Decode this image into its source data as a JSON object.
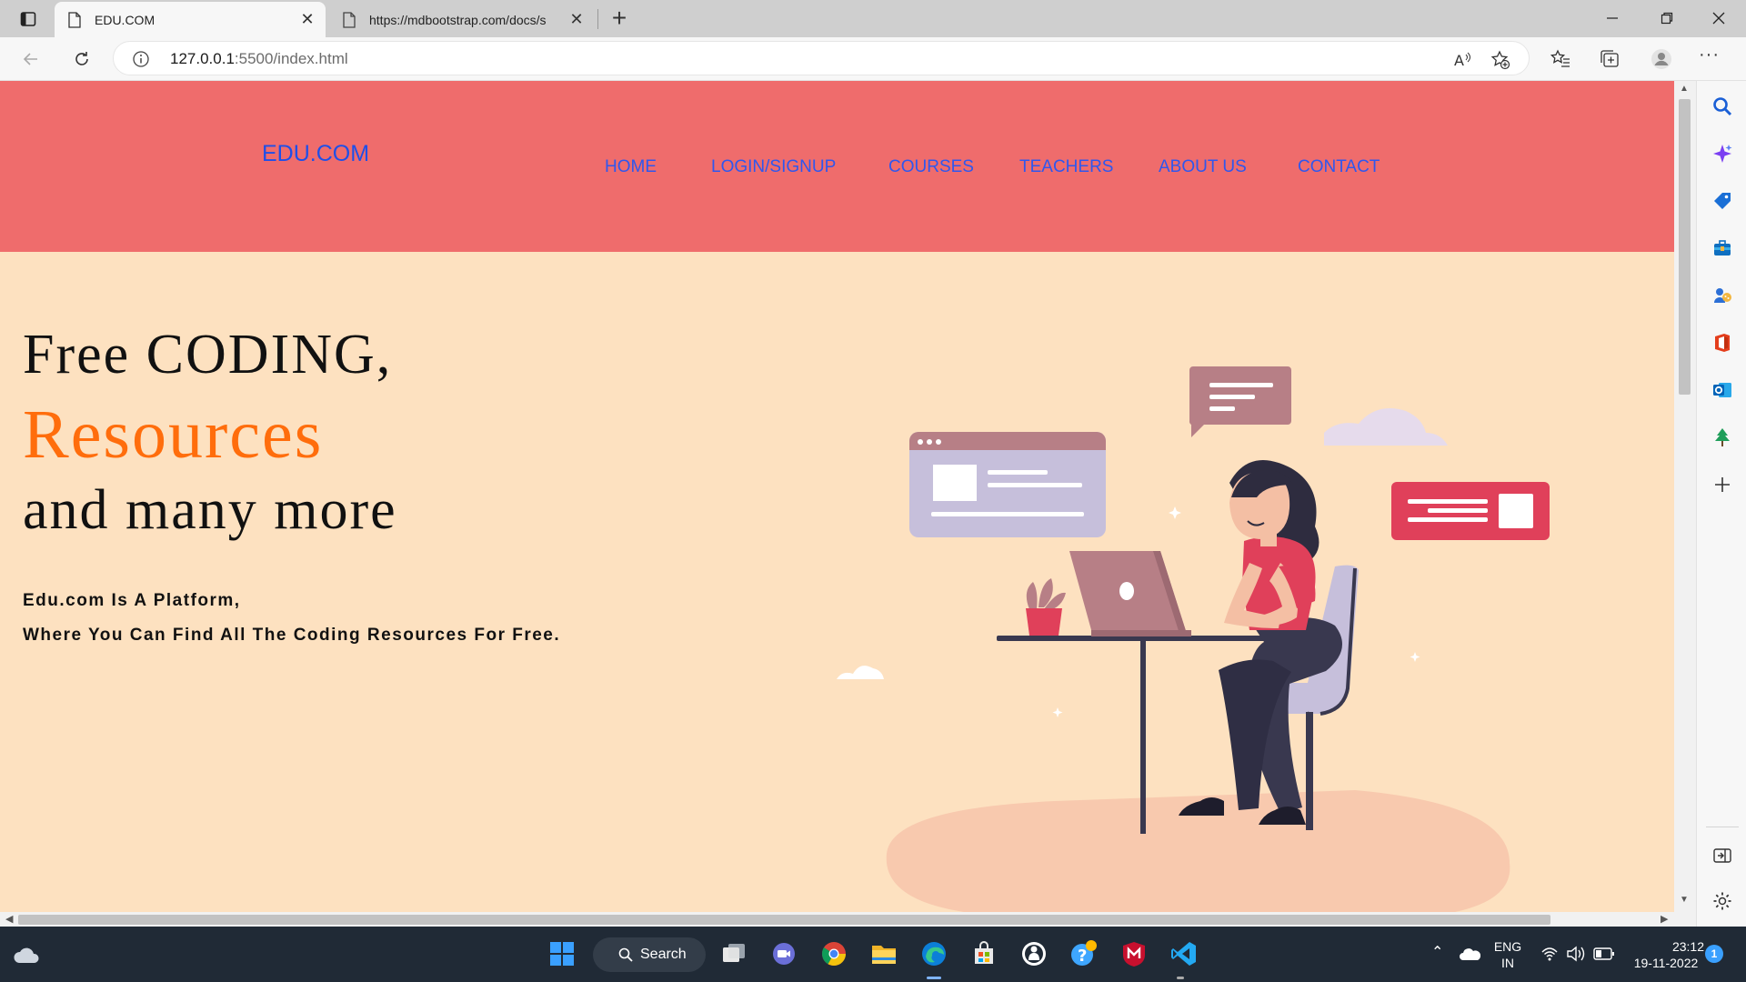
{
  "browser": {
    "tabs": [
      {
        "title": "EDU.COM",
        "active": true
      },
      {
        "title": "https://mdbootstrap.com/docs/s",
        "active": false
      }
    ],
    "address": {
      "host": "127.0.0.1",
      "path": ":5500/index.html"
    }
  },
  "site": {
    "brand": "EDU.COM",
    "nav": [
      "HOME",
      "LOGIN/SIGNUP",
      "COURSES",
      "TEACHERS",
      "ABOUT US",
      "CONTACT"
    ],
    "hero": {
      "line1": "Free CODING,",
      "line2": "Resources",
      "line3": "and many more",
      "desc1": "Edu.com Is A Platform,",
      "desc2": "Where You Can Find All The Coding Resources For Free."
    },
    "colors": {
      "header": "#ef6c6c",
      "background": "#fde1c0",
      "accent": "#ff6d0c",
      "nav_link": "#2f57ee"
    }
  },
  "taskbar": {
    "search_label": "Search",
    "lang_top": "ENG",
    "lang_bottom": "IN",
    "time": "23:12",
    "date": "19-11-2022",
    "notification_count": "1"
  }
}
